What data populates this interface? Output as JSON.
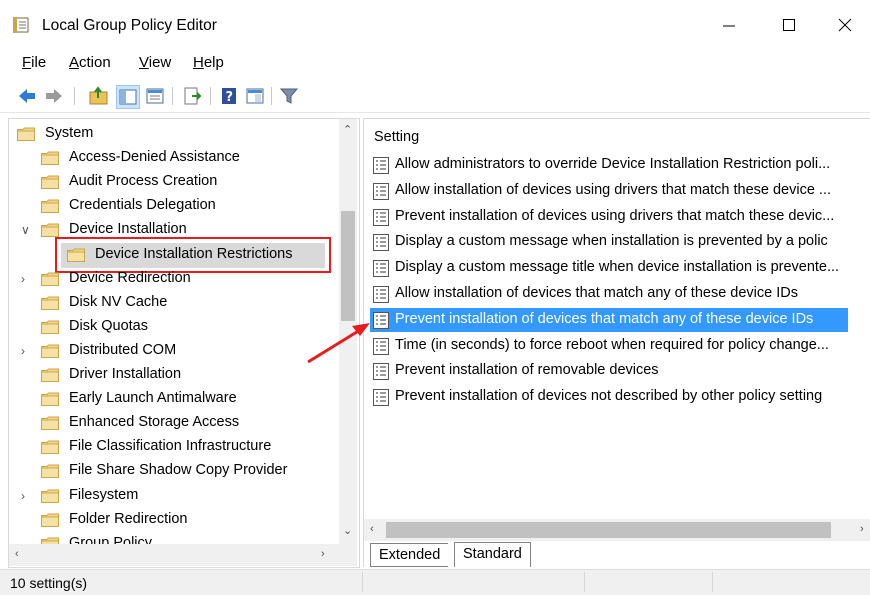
{
  "window": {
    "title": "Local Group Policy Editor",
    "icon": "policy-icon",
    "controls": [
      "minimize",
      "maximize",
      "close"
    ]
  },
  "menu": {
    "items": [
      {
        "label": "ile",
        "key": "F"
      },
      {
        "label": "ction",
        "key": "A"
      },
      {
        "label": "iew",
        "key": "V"
      },
      {
        "label": "elp",
        "key": "H"
      }
    ]
  },
  "toolbar": {
    "icons": [
      "back-icon",
      "forward-icon",
      "up-folder-icon",
      "show-hide-tree-icon",
      "export-list-icon",
      "help-icon",
      "properties-pane-icon",
      "filter-icon"
    ]
  },
  "tree": {
    "items": [
      {
        "label": "System",
        "expander": ""
      },
      {
        "label": "Access-Denied Assistance",
        "expander": ""
      },
      {
        "label": "Audit Process Creation",
        "expander": ""
      },
      {
        "label": "Credentials Delegation",
        "expander": ""
      },
      {
        "label": "Device Installation",
        "expander": "∨"
      },
      {
        "label": "Device Installation Restrictions",
        "expander": ""
      },
      {
        "label": "Device Redirection",
        "expander": "›"
      },
      {
        "label": "Disk NV Cache",
        "expander": ""
      },
      {
        "label": "Disk Quotas",
        "expander": ""
      },
      {
        "label": "Distributed COM",
        "expander": "›"
      },
      {
        "label": "Driver Installation",
        "expander": ""
      },
      {
        "label": "Early Launch Antimalware",
        "expander": ""
      },
      {
        "label": "Enhanced Storage Access",
        "expander": ""
      },
      {
        "label": "File Classification Infrastructure",
        "expander": ""
      },
      {
        "label": "File Share Shadow Copy Provider",
        "expander": ""
      },
      {
        "label": "Filesystem",
        "expander": "›"
      },
      {
        "label": "Folder Redirection",
        "expander": ""
      },
      {
        "label": "Group Policy",
        "expander": ""
      }
    ],
    "selected": "Device Installation Restrictions"
  },
  "settings": {
    "column_header": "Setting",
    "items": [
      {
        "label": "Allow administrators to override Device Installation Restriction poli...",
        "selected": false
      },
      {
        "label": "Allow installation of devices using drivers that match these device ...",
        "selected": false
      },
      {
        "label": "Prevent installation of devices using drivers that match these devic...",
        "selected": false
      },
      {
        "label": "Display a custom message when installation is prevented by a polic",
        "selected": false
      },
      {
        "label": "Display a custom message title when device installation is prevente...",
        "selected": false
      },
      {
        "label": "Allow installation of devices that match any of these device IDs",
        "selected": false
      },
      {
        "label": "Prevent installation of devices that match any of these device IDs",
        "selected": true
      },
      {
        "label": "Time (in seconds) to force reboot when required for policy change...",
        "selected": false
      },
      {
        "label": "Prevent installation of removable devices",
        "selected": false
      },
      {
        "label": "Prevent installation of devices not described by other policy setting",
        "selected": false
      }
    ]
  },
  "tabs": [
    {
      "label": "Extended",
      "active": false
    },
    {
      "label": "Standard",
      "active": true
    }
  ],
  "status": {
    "text": "10 setting(s)"
  },
  "colors": {
    "selection": "#3399ff",
    "annotation": "#e81c1c",
    "folder": "#f3d58a"
  }
}
